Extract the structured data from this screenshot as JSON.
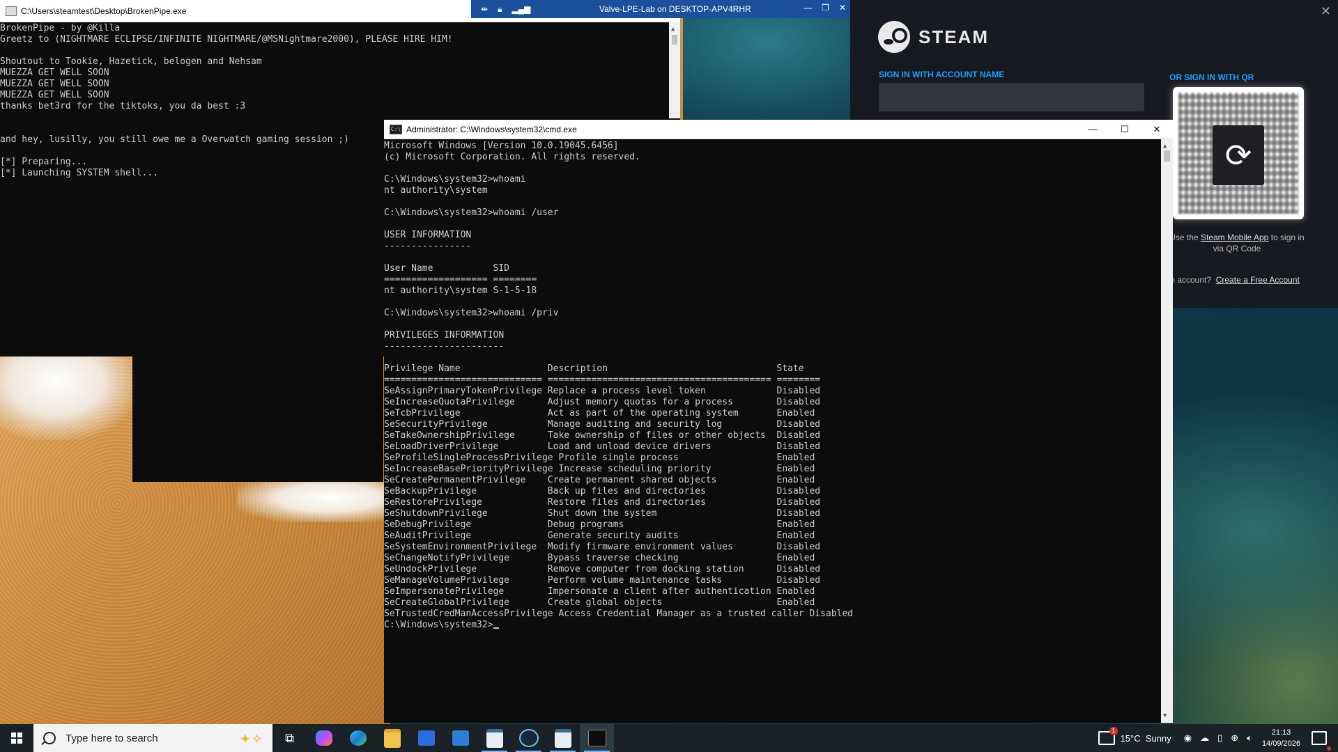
{
  "brokenpipe": {
    "title": "C:\\Users\\steamtest\\Desktop\\BrokenPipe.exe",
    "output": "BrokenPipe - by @Killa\nGreetz to (NIGHTMARE ECLIPSE/INFINITE NIGHTMARE/@MSNightmare2000), PLEASE HIRE HIM!\n\nShoutout to Tookie, Hazetick, belogen and Nehsam\nMUEZZA GET WELL SOON\nMUEZZA GET WELL SOON\nMUEZZA GET WELL SOON\nthanks bet3rd for the tiktoks, you da best :3\n\n\nand hey, lusilly, you still owe me a Overwatch gaming session ;)\n\n[*] Preparing...\n[*] Launching SYSTEM shell..."
  },
  "rdp": {
    "title": "Valve-LPE-Lab on DESKTOP-APV4RHR",
    "icons": [
      "pin-icon",
      "lock-icon",
      "signal-icon"
    ]
  },
  "cmd": {
    "title": "Administrator: C:\\Windows\\system32\\cmd.exe",
    "output": "Microsoft Windows [Version 10.0.19045.6456]\n(c) Microsoft Corporation. All rights reserved.\n\nC:\\Windows\\system32>whoami\nnt authority\\system\n\nC:\\Windows\\system32>whoami /user\n\nUSER INFORMATION\n----------------\n\nUser Name           SID\n=================== ========\nnt authority\\system S-1-5-18\n\nC:\\Windows\\system32>whoami /priv\n\nPRIVILEGES INFORMATION\n----------------------\n\nPrivilege Name                Description                               State\n============================= ========================================= ========\nSeAssignPrimaryTokenPrivilege Replace a process level token             Disabled\nSeIncreaseQuotaPrivilege      Adjust memory quotas for a process        Disabled\nSeTcbPrivilege                Act as part of the operating system       Enabled\nSeSecurityPrivilege           Manage auditing and security log          Disabled\nSeTakeOwnershipPrivilege      Take ownership of files or other objects  Disabled\nSeLoadDriverPrivilege         Load and unload device drivers            Disabled\nSeProfileSingleProcessPrivilege Profile single process                  Enabled\nSeIncreaseBasePriorityPrivilege Increase scheduling priority            Enabled\nSeCreatePermanentPrivilege    Create permanent shared objects           Enabled\nSeBackupPrivilege             Back up files and directories             Disabled\nSeRestorePrivilege            Restore files and directories             Disabled\nSeShutdownPrivilege           Shut down the system                      Disabled\nSeDebugPrivilege              Debug programs                            Enabled\nSeAuditPrivilege              Generate security audits                  Enabled\nSeSystemEnvironmentPrivilege  Modify firmware environment values        Disabled\nSeChangeNotifyPrivilege       Bypass traverse checking                  Enabled\nSeUndockPrivilege             Remove computer from docking station      Disabled\nSeManageVolumePrivilege       Perform volume maintenance tasks          Disabled\nSeImpersonatePrivilege        Impersonate a client after authentication Enabled\nSeCreateGlobalPrivilege       Create global objects                     Enabled\nSeTrustedCredManAccessPrivilege Access Credential Manager as a trusted caller Disabled\n",
    "prompt": "C:\\Windows\\system32>",
    "controls": {
      "minimize": "—",
      "maximize": "☐",
      "close": "✕"
    }
  },
  "steam": {
    "wordmark": "STEAM",
    "signin_label": "SIGN IN WITH ACCOUNT NAME",
    "qr_label": "OR SIGN IN WITH QR",
    "qr_hint_prefix": "Use the ",
    "qr_hint_link": "Steam Mobile App",
    "qr_hint_suffix": " to sign in via QR Code",
    "create_prefix": "m account?",
    "create_link": "Create a Free Account",
    "close": "✕"
  },
  "taskbar": {
    "search_placeholder": "Type here to search",
    "apps": [
      "task-view-icon",
      "copilot-icon",
      "edge-icon",
      "file-explorer-icon",
      "store-icon",
      "mail-icon",
      "app-icon",
      "steam-icon",
      "app-icon",
      "terminal-icon"
    ],
    "weather_badge": "1",
    "weather_temp": "15°C",
    "weather_cond": "Sunny",
    "time": "21:13",
    "date": "14/09/2026"
  }
}
